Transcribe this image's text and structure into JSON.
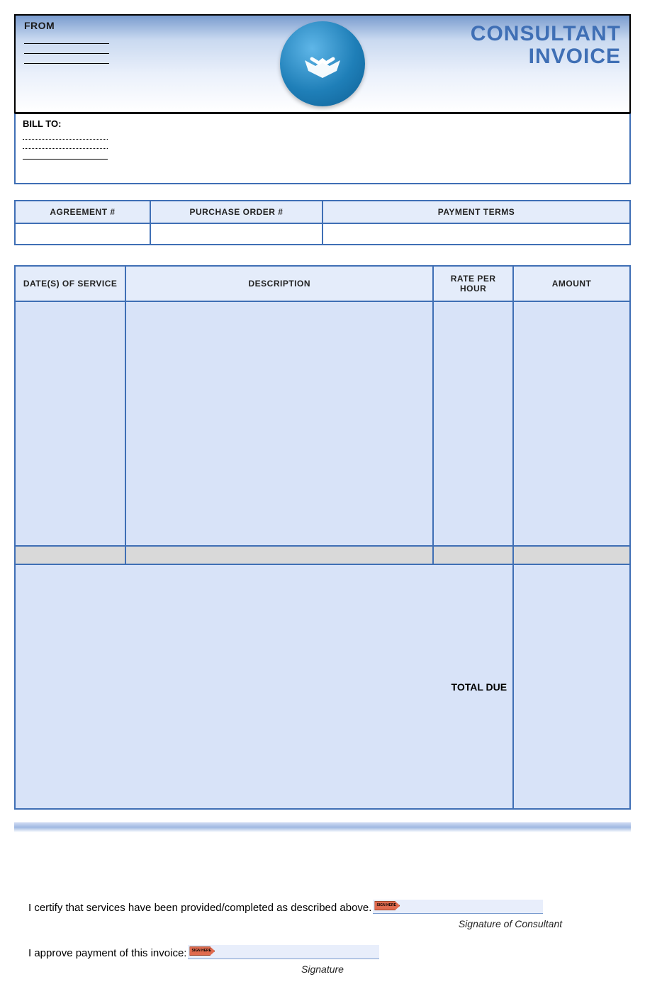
{
  "header": {
    "from_label": "FROM",
    "title_line1": "CONSULTANT",
    "title_line2": "INVOICE"
  },
  "billto": {
    "label": "BILL TO:"
  },
  "meta": {
    "agreement_label": "AGREEMENT #",
    "po_label": "PURCHASE ORDER #",
    "terms_label": "PAYMENT TERMS",
    "agreement_value": "",
    "po_value": "",
    "terms_value": ""
  },
  "items": {
    "col_date": "DATE(S) OF SERVICE",
    "col_desc": "DESCRIPTION",
    "col_rate": "RATE PER HOUR",
    "col_amount": "AMOUNT"
  },
  "totals": {
    "total_due_label": "TOTAL DUE",
    "total_due_value": ""
  },
  "signatures": {
    "certify_text": "I certify that services have been provided/completed as described above.",
    "certify_caption": "Signature of Consultant",
    "approve_text": "I approve payment of this invoice:",
    "approve_caption": "Signature",
    "tag_text": "SIGN HERE"
  }
}
